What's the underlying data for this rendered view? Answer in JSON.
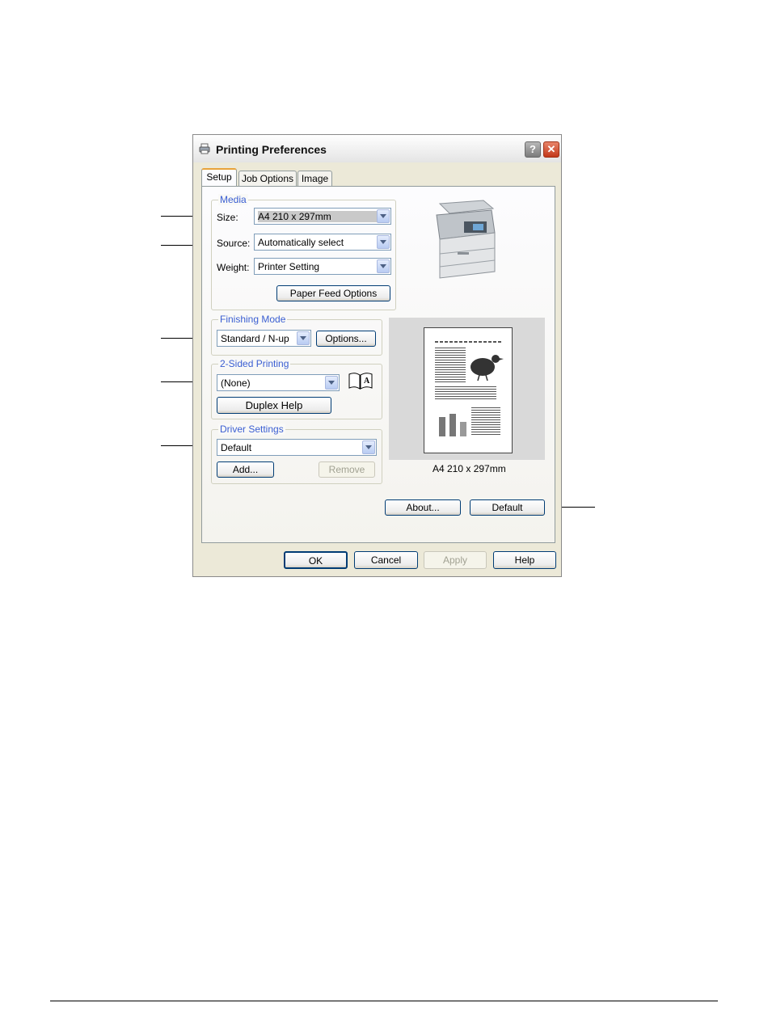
{
  "window": {
    "title": "Printing Preferences",
    "help_glyph": "?",
    "close_glyph": "✕",
    "icon": "printer-icon"
  },
  "tabs": [
    "Setup",
    "Job Options",
    "Image"
  ],
  "media": {
    "group_label": "Media",
    "size_label": "Size:",
    "size_value": "A4 210 x 297mm",
    "source_label": "Source:",
    "source_value": "Automatically select",
    "weight_label": "Weight:",
    "weight_value": "Printer Setting",
    "paper_feed_button": "Paper Feed Options"
  },
  "finishing": {
    "group_label": "Finishing Mode",
    "value": "Standard / N-up",
    "options_button": "Options..."
  },
  "two_sided": {
    "group_label": "2-Sided Printing",
    "value": "(None)",
    "duplex_help_button": "Duplex Help",
    "icon": "book-icon"
  },
  "driver": {
    "group_label": "Driver Settings",
    "value": "Default",
    "add_button": "Add...",
    "remove_button": "Remove"
  },
  "preview": {
    "paper_size_caption": "A4 210 x 297mm"
  },
  "panel_buttons": {
    "about": "About...",
    "default": "Default"
  },
  "footer_buttons": {
    "ok": "OK",
    "cancel": "Cancel",
    "apply": "Apply",
    "help": "Help"
  }
}
